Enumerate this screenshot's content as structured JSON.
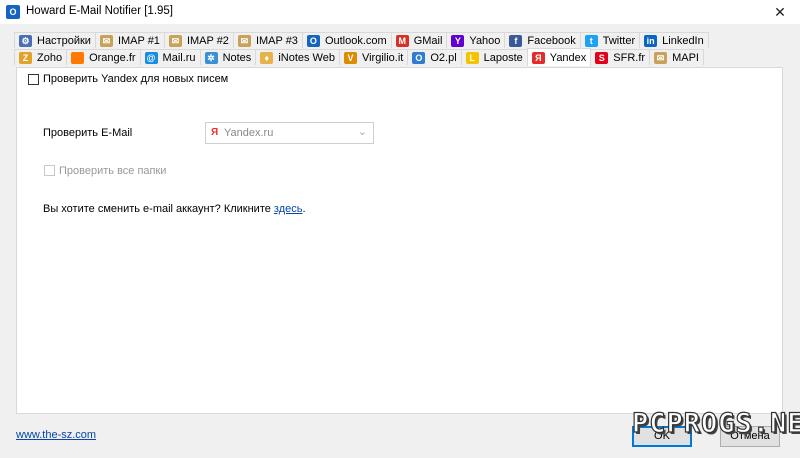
{
  "window": {
    "title": "Howard E-Mail Notifier [1.95]",
    "close": "✕"
  },
  "tabs_row1": [
    {
      "label": "Настройки",
      "icon": "settings-icon",
      "color": "#4a6fb5",
      "glyph": "⚙"
    },
    {
      "label": "IMAP #1",
      "icon": "envelope-icon",
      "color": "#c9a25a",
      "glyph": "✉"
    },
    {
      "label": "IMAP #2",
      "icon": "envelope-icon",
      "color": "#c9a25a",
      "glyph": "✉"
    },
    {
      "label": "IMAP #3",
      "icon": "envelope-icon",
      "color": "#c9a25a",
      "glyph": "✉"
    },
    {
      "label": "Outlook.com",
      "icon": "outlook-icon",
      "color": "#1565c0",
      "glyph": "O"
    },
    {
      "label": "GMail",
      "icon": "gmail-icon",
      "color": "#d93025",
      "glyph": "M"
    },
    {
      "label": "Yahoo",
      "icon": "yahoo-icon",
      "color": "#6001d2",
      "glyph": "Y"
    },
    {
      "label": "Facebook",
      "icon": "facebook-icon",
      "color": "#3b5998",
      "glyph": "f"
    },
    {
      "label": "Twitter",
      "icon": "twitter-icon",
      "color": "#1da1f2",
      "glyph": "t"
    },
    {
      "label": "LinkedIn",
      "icon": "linkedin-icon",
      "color": "#0a66c2",
      "glyph": "in"
    }
  ],
  "tabs_row2": [
    {
      "label": "Zoho",
      "icon": "zoho-icon",
      "color": "#e2a32a",
      "glyph": "Z"
    },
    {
      "label": "Orange.fr",
      "icon": "orange-icon",
      "color": "#ff7900",
      "glyph": " "
    },
    {
      "label": "Mail.ru",
      "icon": "mailru-icon",
      "color": "#168de2",
      "glyph": "@"
    },
    {
      "label": "Notes",
      "icon": "notes-icon",
      "color": "#3a8fd6",
      "glyph": "✲"
    },
    {
      "label": "iNotes Web",
      "icon": "inotes-icon",
      "color": "#e8b14a",
      "glyph": "♦"
    },
    {
      "label": "Virgilio.it",
      "icon": "virgilio-icon",
      "color": "#e08a00",
      "glyph": "V"
    },
    {
      "label": "O2.pl",
      "icon": "o2-icon",
      "color": "#2e7dd1",
      "glyph": "O"
    },
    {
      "label": "Laposte",
      "icon": "laposte-icon",
      "color": "#f5c400",
      "glyph": "L"
    },
    {
      "label": "Yandex",
      "icon": "yandex-icon",
      "color": "#e32c2c",
      "glyph": "Я",
      "active": true
    },
    {
      "label": "SFR.fr",
      "icon": "sfr-icon",
      "color": "#e2001a",
      "glyph": "S"
    },
    {
      "label": "MAPI",
      "icon": "envelope-icon",
      "color": "#c9a25a",
      "glyph": "✉"
    }
  ],
  "panel": {
    "check_new_label": "Проверить Yandex для новых писем",
    "email_label": "Проверить E-Mail",
    "email_value": "Yandex.ru",
    "all_folders_label": "Проверить все папки",
    "change_text": "Вы хотите сменить e-mail аккаунт? Кликните ",
    "change_link": "здесь",
    "change_dot": "."
  },
  "footer": {
    "site_link": "www.the-sz.com",
    "ok": "OK",
    "cancel": "Отмена"
  },
  "watermark": "PCPROGS.NET"
}
